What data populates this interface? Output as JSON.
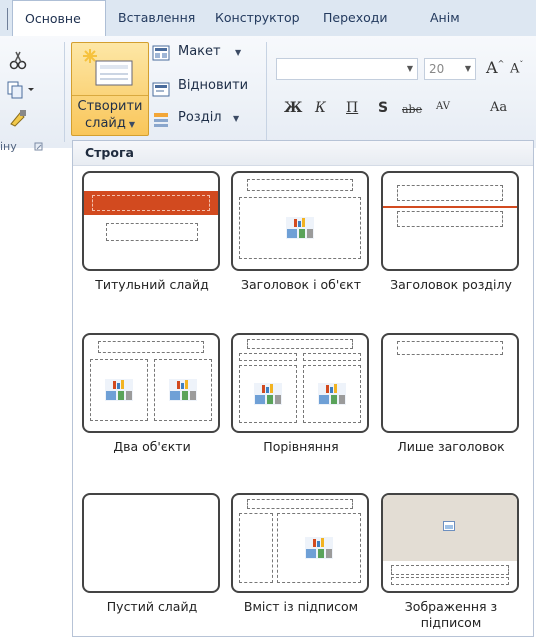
{
  "tabs": [
    "Основне",
    "Вставлення",
    "Конструктор",
    "Переходи",
    "Анім"
  ],
  "ribbon": {
    "new_slide_label_line1": "Створити",
    "new_slide_label_line2": "слайд",
    "layout_label": "Макет",
    "reset_label": "Відновити",
    "section_label": "Розділ",
    "clipboard_group_label": "іну",
    "font_size_value": "20",
    "format_buttons": [
      "Ж",
      "К",
      "П",
      "S",
      "abe",
      "AV",
      "Aa"
    ]
  },
  "gallery": {
    "title": "Строга",
    "layouts": [
      "Титульний слайд",
      "Заголовок і об'єкт",
      "Заголовок розділу",
      "Два об'єкти",
      "Порівняння",
      "Лише заголовок",
      "Пустий слайд",
      "Вміст із підписом",
      "Зображення з підписом"
    ]
  },
  "colors": {
    "accent_orange": "#d24a1f",
    "header_bg": "#dde7f2"
  }
}
